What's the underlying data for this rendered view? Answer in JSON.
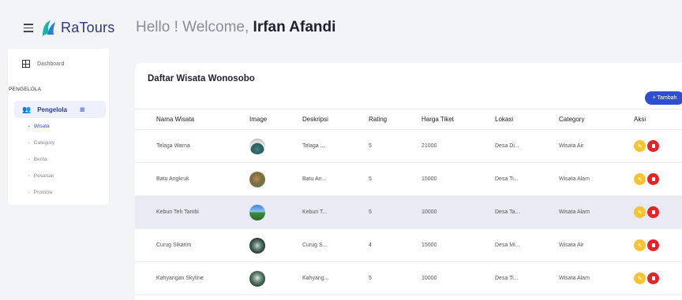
{
  "app": {
    "name": "RaTours"
  },
  "header": {
    "greeting": "Hello ! Welcome,",
    "user_name": "Irfan Afandi"
  },
  "sidebar": {
    "dashboard_label": "Dashboard",
    "section_label": "PENGELOLA",
    "group_label": "Pengelola",
    "items": [
      {
        "label": "Wisata",
        "active": true
      },
      {
        "label": "Category",
        "active": false
      },
      {
        "label": "Berita",
        "active": false
      },
      {
        "label": "Pesanan",
        "active": false
      },
      {
        "label": "Promosi",
        "active": false
      }
    ]
  },
  "main": {
    "title": "Daftar Wisata Wonosobo",
    "add_button_label": "+ Tambah",
    "columns": [
      "Nama Wisata",
      "Image",
      "Deskripsi",
      "Rating",
      "Harga Tiket",
      "Lokasi",
      "Category",
      "Aksi"
    ],
    "rows": [
      {
        "name": "Telaga Warna",
        "description": "Telaga ...",
        "rating": "5",
        "price": "21000",
        "location": "Desa Di...",
        "category": "Wisata Air"
      },
      {
        "name": "Batu Angkruk",
        "description": "Batu An...",
        "rating": "5",
        "price": "15000",
        "location": "Desa Ti...",
        "category": "Wisata Alam"
      },
      {
        "name": "Kebun Teh Tambi",
        "description": "Kebun T...",
        "rating": "5",
        "price": "10000",
        "location": "Desa Ta...",
        "category": "Wisata Alam"
      },
      {
        "name": "Curug Sikarim",
        "description": "Curug S...",
        "rating": "4",
        "price": "15000",
        "location": "Desa Mi...",
        "category": "Wisata Air"
      },
      {
        "name": "Kahyangan Skyline",
        "description": "Kahyang...",
        "rating": "5",
        "price": "10000",
        "location": "Desa Ti...",
        "category": "Wisata Alam"
      }
    ]
  },
  "colors": {
    "accent": "#2f4fd0",
    "edit": "#f6c431",
    "delete": "#e0252b",
    "highlight_row": "#e9eaf4"
  }
}
